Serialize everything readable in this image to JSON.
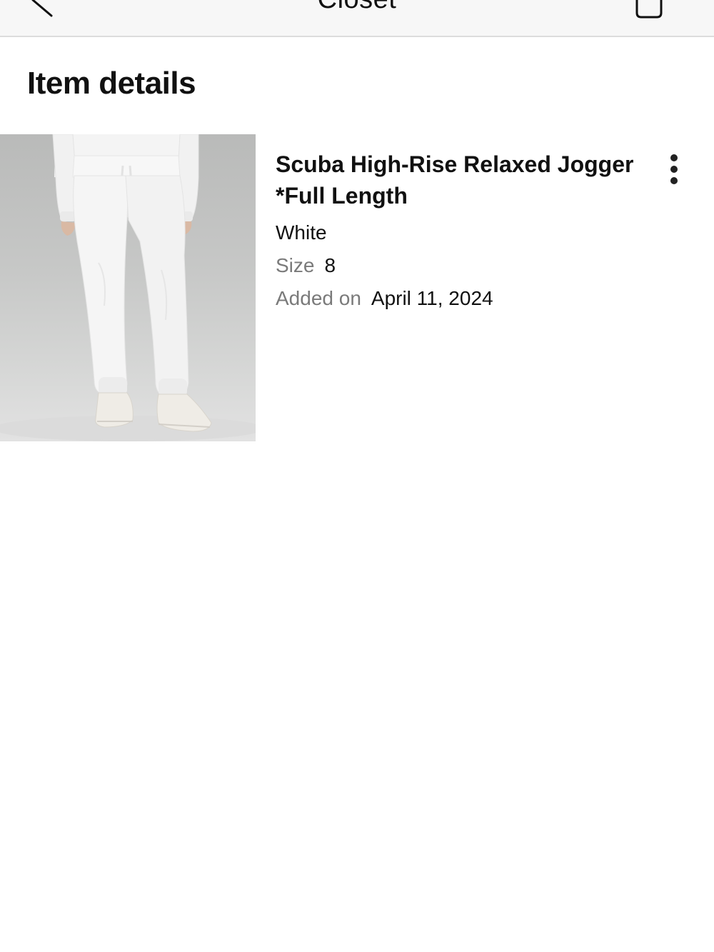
{
  "header": {
    "title": "Closet",
    "back_icon": "chevron-left-icon",
    "bag_icon": "shopping-bag-icon"
  },
  "page": {
    "title": "Item details"
  },
  "item": {
    "name": "Scuba High-Rise Relaxed Jogger *Full Length",
    "color": "White",
    "size_label": "Size",
    "size_value": "8",
    "added_label": "Added on",
    "added_value": "April 11, 2024",
    "more_icon": "more-vertical-icon"
  },
  "colors": {
    "nav_background": "#f7f7f7",
    "text_primary": "#111111",
    "text_secondary": "#7a7a7a",
    "divider": "#dcdcdc"
  }
}
